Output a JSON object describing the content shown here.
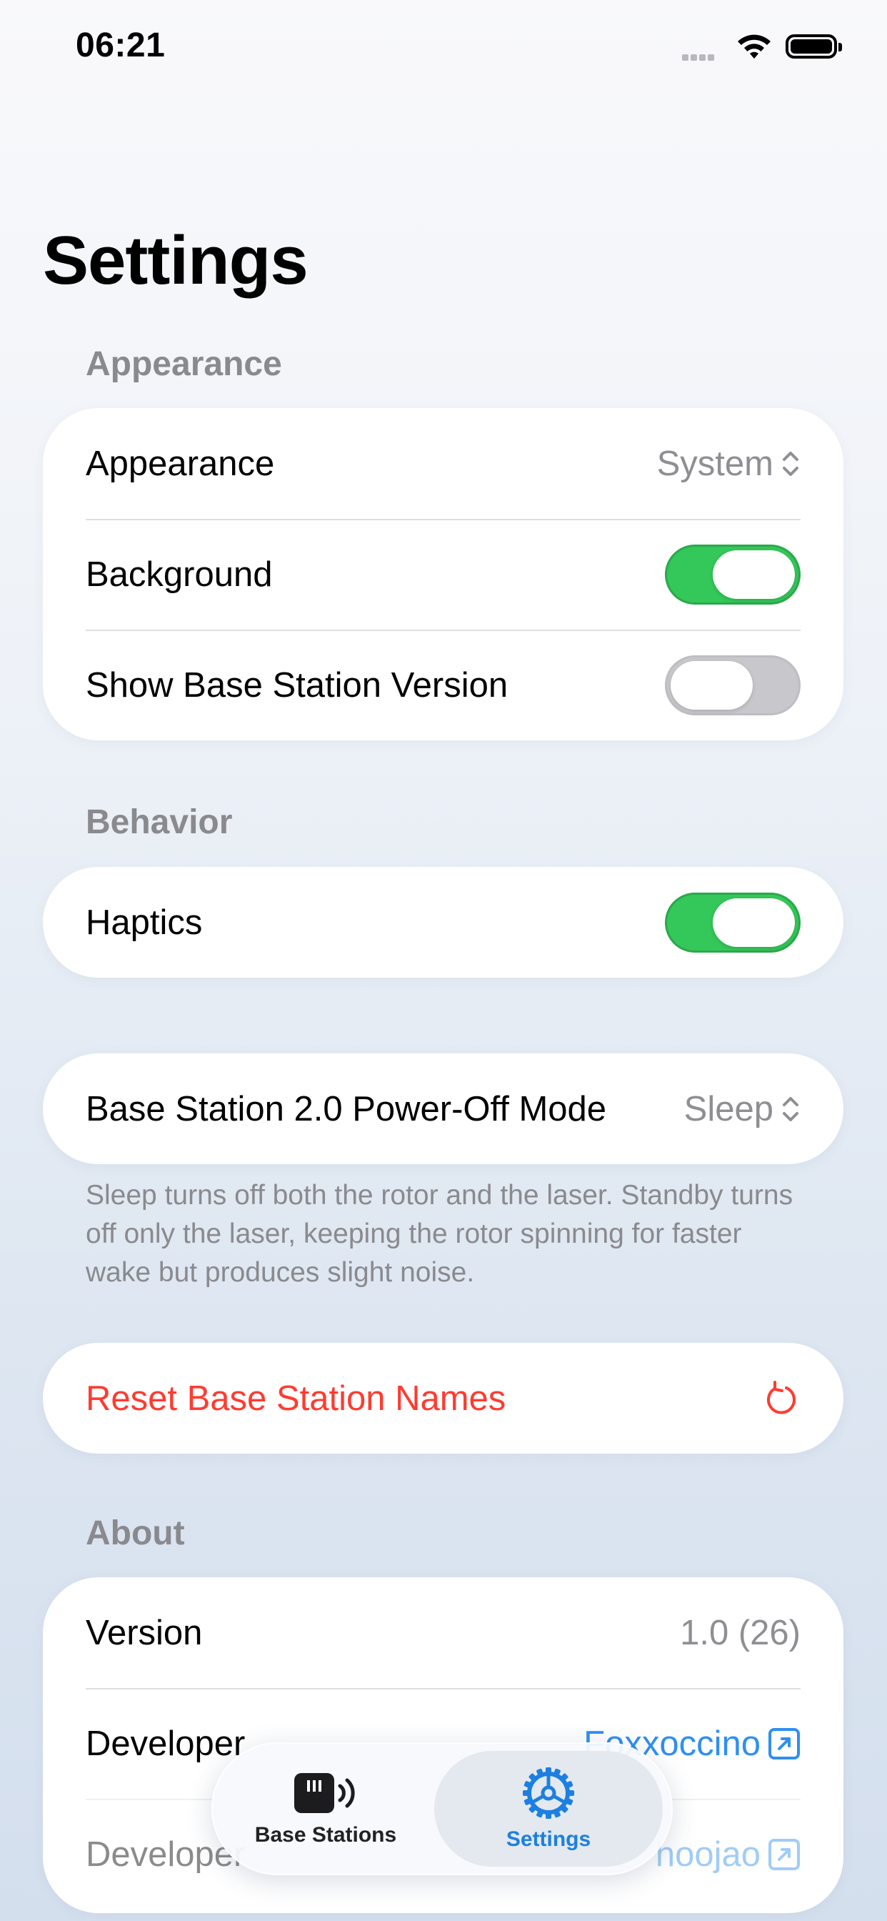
{
  "status_bar": {
    "time": "06:21"
  },
  "page": {
    "title": "Settings"
  },
  "sections": {
    "appearance": {
      "header": "Appearance",
      "rows": [
        {
          "label": "Appearance",
          "value": "System"
        },
        {
          "label": "Background",
          "toggle": true
        },
        {
          "label": "Show Base Station Version",
          "toggle": false
        }
      ]
    },
    "behavior": {
      "header": "Behavior",
      "rows": [
        {
          "label": "Haptics",
          "toggle": true
        }
      ]
    },
    "power": {
      "label": "Base Station 2.0 Power-Off Mode",
      "value": "Sleep",
      "footnote": "Sleep turns off both the rotor and the laser. Standby turns off only the laser, keeping the rotor spinning for faster wake but produces slight noise."
    },
    "reset": {
      "label": "Reset Base Station Names"
    },
    "about": {
      "header": "About",
      "rows": [
        {
          "label": "Version",
          "value": "1.0 (26)"
        },
        {
          "label": "Developer",
          "value": "Foxxoccino"
        },
        {
          "label": "Developer",
          "value": "hoojao"
        }
      ]
    }
  },
  "tabbar": {
    "tabs": [
      {
        "label": "Base Stations",
        "icon": "base-station-icon",
        "selected": false
      },
      {
        "label": "Settings",
        "icon": "gear-icon",
        "selected": true
      }
    ]
  },
  "colors": {
    "toggle_on": "#34c759",
    "destructive": "#ff3b30",
    "link": "#2f8ff0",
    "accent": "#1d7fe0"
  }
}
